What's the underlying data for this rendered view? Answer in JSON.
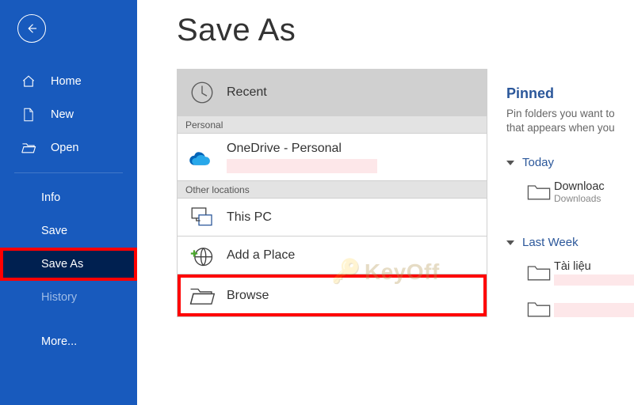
{
  "page": {
    "title": "Save As"
  },
  "sidebar": {
    "home": "Home",
    "new": "New",
    "open": "Open",
    "info": "Info",
    "save": "Save",
    "save_as": "Save As",
    "history": "History",
    "more": "More..."
  },
  "locations": {
    "recent": "Recent",
    "personal_header": "Personal",
    "onedrive": "OneDrive - Personal",
    "other_header": "Other locations",
    "this_pc": "This PC",
    "add_place": "Add a Place",
    "browse": "Browse"
  },
  "pinned": {
    "title": "Pinned",
    "hint_line1": "Pin folders you want to",
    "hint_line2": "that appears when you",
    "today": "Today",
    "download_name": "Downloac",
    "download_sub": "Downloads",
    "last_week": "Last Week",
    "doc_name": "Tài liệu"
  },
  "watermark": "KeyOff"
}
